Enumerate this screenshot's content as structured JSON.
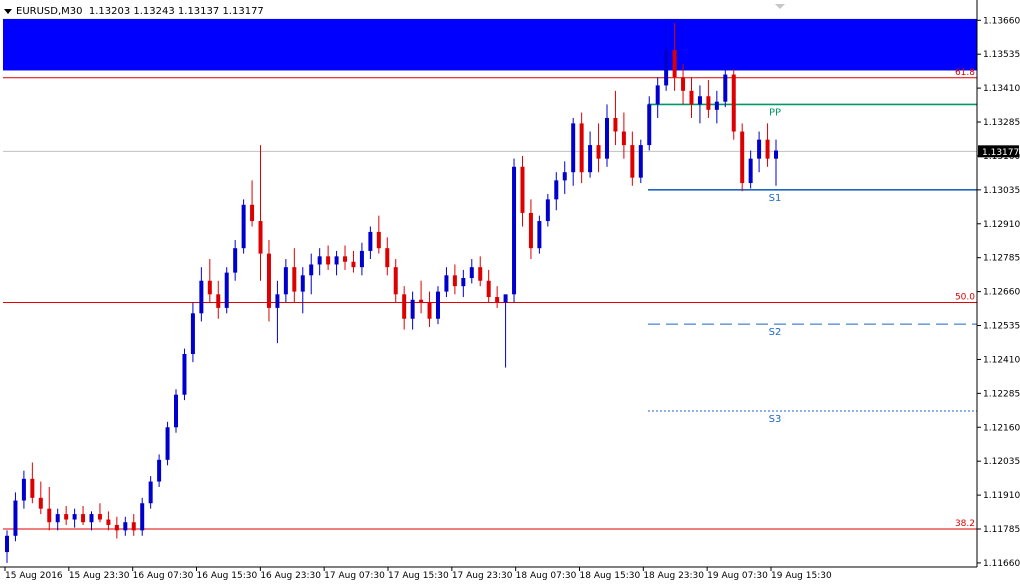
{
  "header": {
    "symbol": "EURUSD,M30",
    "ohlc": "1.13203 1.13243 1.13137 1.13177"
  },
  "colors": {
    "bull": "#0000cc",
    "bear": "#dd0000",
    "zone": "#0000ff",
    "fib": "#e00000",
    "pivot": "#009966",
    "support": "#1e66c8",
    "price_line": "#c0c0c0",
    "axis": "#000000"
  },
  "chart_data": {
    "type": "candlestick",
    "y_ticks": [
      "1.13660",
      "1.13535",
      "1.13410",
      "1.13285",
      "1.13160",
      "1.13035",
      "1.12910",
      "1.12785",
      "1.12660",
      "1.12535",
      "1.12410",
      "1.12285",
      "1.12160",
      "1.12035",
      "1.11910",
      "1.11785",
      "1.11660"
    ],
    "ylim": [
      1.11645,
      1.1372
    ],
    "x_ticks": [
      "15 Aug 2016",
      "15 Aug 23:30",
      "16 Aug 07:30",
      "16 Aug 15:30",
      "16 Aug 23:30",
      "17 Aug 07:30",
      "17 Aug 15:30",
      "17 Aug 23:30",
      "18 Aug 07:30",
      "18 Aug 15:30",
      "18 Aug 23:30",
      "19 Aug 07:30",
      "19 Aug 15:30"
    ],
    "current_price": "1.13177",
    "current_value": 1.13177,
    "zone": {
      "from": 1.13665,
      "to": 1.13475
    },
    "fib_levels": [
      {
        "label": "61.8",
        "value": 1.13448
      },
      {
        "label": "50.0",
        "value": 1.1262
      },
      {
        "label": "38.2",
        "value": 1.11785
      }
    ],
    "pivots": [
      {
        "label": "PP",
        "value": 1.1335,
        "style": "solid",
        "color": "pivot"
      },
      {
        "label": "S1",
        "value": 1.13035,
        "style": "solid",
        "color": "support"
      },
      {
        "label": "S2",
        "value": 1.1254,
        "style": "dashed",
        "color": "support"
      },
      {
        "label": "S3",
        "value": 1.1222,
        "style": "dotted",
        "color": "support"
      }
    ],
    "candles": [
      [
        1.117,
        1.1178,
        1.1166,
        1.1176
      ],
      [
        1.1176,
        1.1192,
        1.1174,
        1.1189
      ],
      [
        1.1189,
        1.12,
        1.1186,
        1.1197
      ],
      [
        1.1197,
        1.1203,
        1.1188,
        1.119
      ],
      [
        1.119,
        1.1196,
        1.1184,
        1.1186
      ],
      [
        1.1186,
        1.1194,
        1.1178,
        1.1181
      ],
      [
        1.1181,
        1.1186,
        1.1178,
        1.1184
      ],
      [
        1.1184,
        1.1187,
        1.118,
        1.1182
      ],
      [
        1.1182,
        1.1186,
        1.1179,
        1.1184
      ],
      [
        1.1184,
        1.1187,
        1.118,
        1.1181
      ],
      [
        1.1181,
        1.1185,
        1.1178,
        1.1184
      ],
      [
        1.1184,
        1.1188,
        1.1181,
        1.1182
      ],
      [
        1.1182,
        1.1185,
        1.1178,
        1.118
      ],
      [
        1.118,
        1.1183,
        1.1175,
        1.1178
      ],
      [
        1.1178,
        1.1183,
        1.1176,
        1.1181
      ],
      [
        1.1181,
        1.1184,
        1.1176,
        1.1178
      ],
      [
        1.1178,
        1.119,
        1.1176,
        1.1188
      ],
      [
        1.1188,
        1.1198,
        1.1186,
        1.1196
      ],
      [
        1.1196,
        1.1206,
        1.1194,
        1.1204
      ],
      [
        1.1204,
        1.1218,
        1.1202,
        1.1216
      ],
      [
        1.1216,
        1.123,
        1.1214,
        1.1228
      ],
      [
        1.1228,
        1.1245,
        1.1226,
        1.1243
      ],
      [
        1.1243,
        1.1262,
        1.124,
        1.1258
      ],
      [
        1.1258,
        1.1275,
        1.1255,
        1.127
      ],
      [
        1.127,
        1.1278,
        1.1262,
        1.1265
      ],
      [
        1.1265,
        1.127,
        1.1256,
        1.126
      ],
      [
        1.126,
        1.1275,
        1.1258,
        1.1273
      ],
      [
        1.1273,
        1.1285,
        1.127,
        1.1282
      ],
      [
        1.1282,
        1.13,
        1.128,
        1.1298
      ],
      [
        1.1298,
        1.1307,
        1.129,
        1.1292
      ],
      [
        1.1292,
        1.132,
        1.127,
        1.128
      ],
      [
        1.128,
        1.1285,
        1.1255,
        1.126
      ],
      [
        1.126,
        1.127,
        1.1247,
        1.1265
      ],
      [
        1.1265,
        1.1278,
        1.1262,
        1.1275
      ],
      [
        1.1275,
        1.1282,
        1.1262,
        1.1266
      ],
      [
        1.1266,
        1.1275,
        1.1258,
        1.1272
      ],
      [
        1.1272,
        1.128,
        1.1265,
        1.1276
      ],
      [
        1.1276,
        1.1282,
        1.1272,
        1.1279
      ],
      [
        1.1279,
        1.1283,
        1.1274,
        1.1276
      ],
      [
        1.1276,
        1.1281,
        1.1272,
        1.1279
      ],
      [
        1.1279,
        1.1283,
        1.1274,
        1.1277
      ],
      [
        1.1277,
        1.1281,
        1.1273,
        1.1275
      ],
      [
        1.1275,
        1.1284,
        1.1272,
        1.1281
      ],
      [
        1.1281,
        1.129,
        1.1278,
        1.1288
      ],
      [
        1.1288,
        1.1294,
        1.128,
        1.1282
      ],
      [
        1.1282,
        1.1286,
        1.1272,
        1.1275
      ],
      [
        1.1275,
        1.1278,
        1.1262,
        1.1265
      ],
      [
        1.1265,
        1.1268,
        1.1252,
        1.1256
      ],
      [
        1.1256,
        1.1266,
        1.1252,
        1.1263
      ],
      [
        1.1263,
        1.127,
        1.1258,
        1.1262
      ],
      [
        1.1262,
        1.1266,
        1.1253,
        1.1256
      ],
      [
        1.1256,
        1.1268,
        1.1254,
        1.1266
      ],
      [
        1.1266,
        1.1275,
        1.1264,
        1.1272
      ],
      [
        1.1272,
        1.1276,
        1.1265,
        1.1268
      ],
      [
        1.1268,
        1.1274,
        1.1264,
        1.1271
      ],
      [
        1.1271,
        1.1278,
        1.1269,
        1.1275
      ],
      [
        1.1275,
        1.1279,
        1.1268,
        1.127
      ],
      [
        1.127,
        1.1274,
        1.1262,
        1.1264
      ],
      [
        1.1264,
        1.1268,
        1.126,
        1.1262
      ],
      [
        1.1262,
        1.1264,
        1.1238,
        1.1265
      ],
      [
        1.1265,
        1.1315,
        1.1262,
        1.1312
      ],
      [
        1.1312,
        1.1316,
        1.129,
        1.1295
      ],
      [
        1.1295,
        1.13,
        1.1278,
        1.1282
      ],
      [
        1.1282,
        1.1294,
        1.128,
        1.1292
      ],
      [
        1.1292,
        1.1302,
        1.129,
        1.13
      ],
      [
        1.13,
        1.131,
        1.1296,
        1.1307
      ],
      [
        1.1307,
        1.1314,
        1.1302,
        1.131
      ],
      [
        1.131,
        1.133,
        1.1305,
        1.1328
      ],
      [
        1.1328,
        1.1332,
        1.1306,
        1.131
      ],
      [
        1.131,
        1.1325,
        1.1308,
        1.132
      ],
      [
        1.132,
        1.1328,
        1.131,
        1.1315
      ],
      [
        1.1315,
        1.1335,
        1.1312,
        1.133
      ],
      [
        1.133,
        1.134,
        1.132,
        1.1325
      ],
      [
        1.1325,
        1.1332,
        1.1315,
        1.132
      ],
      [
        1.132,
        1.1325,
        1.1305,
        1.1308
      ],
      [
        1.1308,
        1.1322,
        1.1306,
        1.132
      ],
      [
        1.132,
        1.1338,
        1.1318,
        1.1335
      ],
      [
        1.1335,
        1.1345,
        1.133,
        1.1342
      ],
      [
        1.1342,
        1.1365,
        1.134,
        1.1355
      ],
      [
        1.1355,
        1.1365,
        1.134,
        1.1345
      ],
      [
        1.1345,
        1.135,
        1.1335,
        1.134
      ],
      [
        1.134,
        1.1345,
        1.133,
        1.1335
      ],
      [
        1.1335,
        1.1342,
        1.1328,
        1.1338
      ],
      [
        1.1338,
        1.1344,
        1.133,
        1.1333
      ],
      [
        1.1333,
        1.134,
        1.1328,
        1.1336
      ],
      [
        1.1336,
        1.1348,
        1.1334,
        1.1346
      ],
      [
        1.1346,
        1.1348,
        1.1322,
        1.1325
      ],
      [
        1.1325,
        1.1328,
        1.1303,
        1.1306
      ],
      [
        1.1306,
        1.1318,
        1.1304,
        1.1315
      ],
      [
        1.1315,
        1.1325,
        1.131,
        1.1322
      ],
      [
        1.1322,
        1.1328,
        1.1312,
        1.1315
      ],
      [
        1.1315,
        1.1322,
        1.1305,
        1.1318
      ]
    ]
  }
}
